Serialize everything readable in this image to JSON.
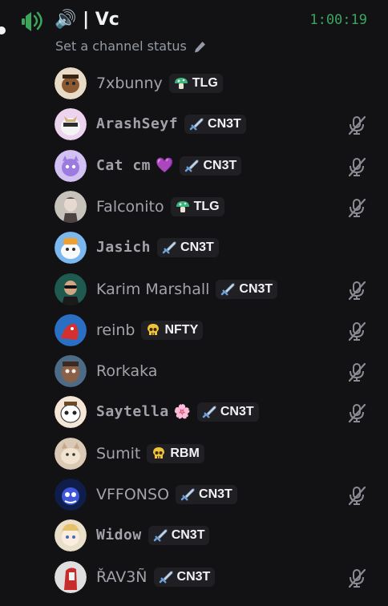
{
  "channel": {
    "icon": "speaker-icon",
    "name": "| Vc",
    "timer": "1:00:19",
    "status_placeholder": "Set a channel status"
  },
  "members": [
    {
      "name": "7xbunny",
      "tag": "TLG",
      "tag_icon": "mushroom-icon",
      "muted": false,
      "fancy": false,
      "suffix": ""
    },
    {
      "name": "ArashSeyf",
      "tag": "CN3T",
      "tag_icon": "sword-icon",
      "muted": true,
      "fancy": true,
      "suffix": ""
    },
    {
      "name": "Cat cm",
      "tag": "CN3T",
      "tag_icon": "sword-icon",
      "muted": true,
      "fancy": true,
      "suffix": "💜"
    },
    {
      "name": "Falconito",
      "tag": "TLG",
      "tag_icon": "mushroom-icon",
      "muted": true,
      "fancy": false,
      "suffix": ""
    },
    {
      "name": "Jasich",
      "tag": "CN3T",
      "tag_icon": "sword-icon",
      "muted": false,
      "fancy": true,
      "suffix": ""
    },
    {
      "name": "Karim Marshall",
      "tag": "CN3T",
      "tag_icon": "sword-icon",
      "muted": true,
      "fancy": false,
      "suffix": ""
    },
    {
      "name": "reinb",
      "tag": "NFTY",
      "tag_icon": "skull-icon",
      "muted": true,
      "fancy": false,
      "suffix": ""
    },
    {
      "name": "Rorkaka",
      "tag": "",
      "tag_icon": "",
      "muted": true,
      "fancy": false,
      "suffix": ""
    },
    {
      "name": "Saytella",
      "tag": "CN3T",
      "tag_icon": "sword-icon",
      "muted": true,
      "fancy": true,
      "suffix": "🌸"
    },
    {
      "name": "Sumit",
      "tag": "RBM",
      "tag_icon": "skull-icon",
      "muted": false,
      "fancy": false,
      "suffix": ""
    },
    {
      "name": "VFFONSO",
      "tag": "CN3T",
      "tag_icon": "sword-icon",
      "muted": true,
      "fancy": false,
      "suffix": ""
    },
    {
      "name": "Widow",
      "tag": "CN3T",
      "tag_icon": "sword-icon",
      "muted": false,
      "fancy": true,
      "suffix": ""
    },
    {
      "name": "ŘAV3Ñ",
      "tag": "CN3T",
      "tag_icon": "sword-icon",
      "muted": true,
      "fancy": false,
      "suffix": ""
    }
  ],
  "colors": {
    "background": "#121215",
    "voice_green": "#3ba55d",
    "text_muted": "#a2a2aa",
    "tag_bg": "#202024"
  }
}
